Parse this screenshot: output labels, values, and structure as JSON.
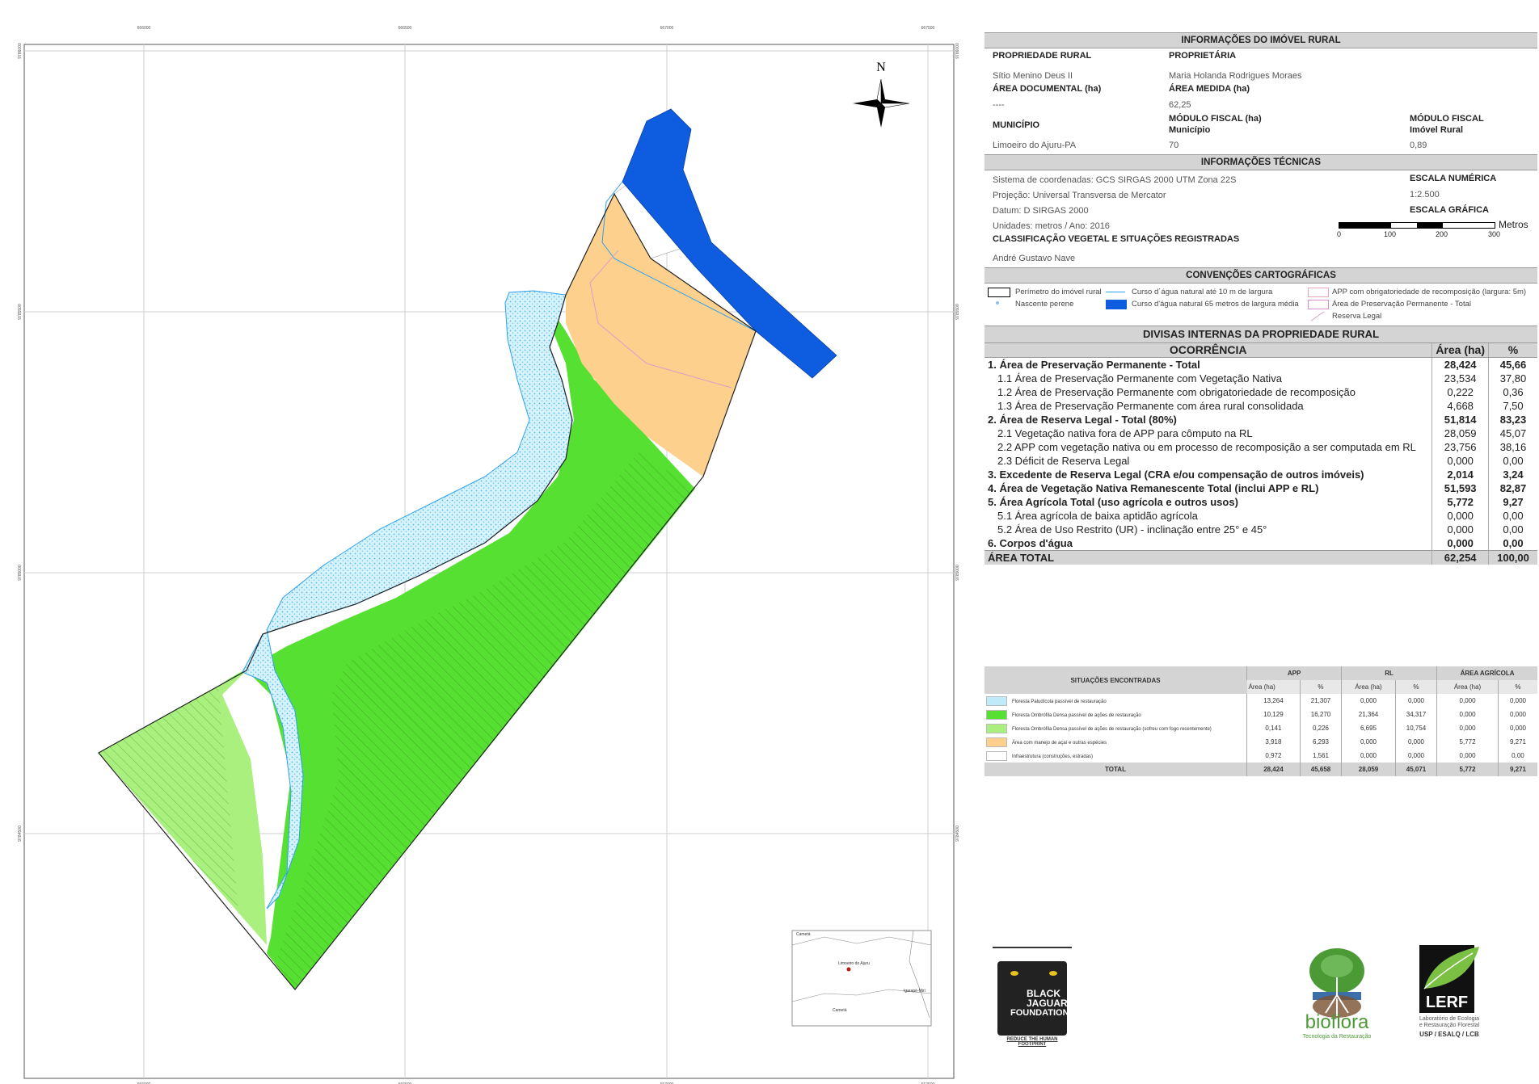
{
  "map": {
    "north_label": "N",
    "top_ticks": [
      "666000",
      "666500",
      "667000",
      "667500"
    ],
    "bottom_ticks": [
      "666000",
      "666500",
      "667000",
      "667500"
    ],
    "left_ticks": [
      "9786000",
      "9785500",
      "9785000",
      "9784500"
    ],
    "right_ticks": [
      "9786000",
      "9785500",
      "9785000",
      "9784500"
    ],
    "colors": {
      "boundary_fill_pasture": "#a9f07f",
      "forest_green": "#56e031",
      "floodplain_blue": "#bfeaf7",
      "acai_orange": "#fdd08e",
      "river_blue": "#0e5de0",
      "stream_blue": "#2ea1f0"
    }
  },
  "inset": {
    "places": [
      "Cametá",
      "Limoeiro do Ajuru",
      "Igarapé-Miri",
      "Cametá"
    ]
  },
  "info": {
    "title": "INFORMAÇÕES DO IMÓVEL RURAL",
    "propriedade_label": "PROPRIEDADE RURAL",
    "propriedade_value": "Sítio Menino Deus II",
    "proprietaria_label": "PROPRIETÁRIA",
    "proprietaria_value": "Maria Holanda Rodrigues Moraes",
    "area_doc_label": "ÁREA DOCUMENTAL (ha)",
    "area_doc_value": "----",
    "area_medida_label": "ÁREA MEDIDA (ha)",
    "area_medida_value": "62,25",
    "municipio_label": "MUNICÍPIO",
    "municipio_value": "Limoeiro do Ajuru-PA",
    "modulo_mun_label1": "MÓDULO FISCAL (ha)",
    "modulo_mun_label2": "Município",
    "modulo_mun_value": "70",
    "modulo_imovel_label1": "MÓDULO FISCAL",
    "modulo_imovel_label2": "Imóvel Rural",
    "modulo_imovel_value": "0,89"
  },
  "tecnicas": {
    "title": "INFORMAÇÕES TÉCNICAS",
    "sistema": "Sistema de coordenadas: GCS SIRGAS 2000 UTM Zona 22S",
    "projecao": "Projeção: Universal Transversa de Mercator",
    "datum": "Datum: D SIRGAS 2000",
    "unidades": "Unidades: metros / Ano: 2016",
    "classificacao_label": "CLASSIFICAÇÃO VEGETAL E SITUAÇÕES REGISTRADAS",
    "classificacao_value": "André Gustavo Nave",
    "escala_num_label": "ESCALA NUMÉRICA",
    "escala_num_value": "1:2.500",
    "escala_graf_label": "ESCALA GRÁFICA",
    "escala_unit": "Metros",
    "escala_ticks": [
      "0",
      "100",
      "200",
      "300"
    ]
  },
  "convencoes": {
    "title": "CONVENÇÕES CARTOGRÁFICAS",
    "items": [
      "Perímetro do imóvel rural",
      "Curso d´água natural até 10 m de largura",
      "APP com obrigatoriedade de recomposição (largura: 5m)",
      "Nascente perene",
      "Curso d'água natural 65 metros de largura média",
      "Área de Preservação Permanente - Total",
      "Reserva Legal"
    ]
  },
  "divisas": {
    "title": "DIVISAS INTERNAS DA PROPRIEDADE RURAL",
    "col_ocorrencia": "OCORRÊNCIA",
    "col_area": "Área (ha)",
    "col_pct": "%",
    "rows": [
      {
        "label": "1. Área de Preservação Permanente - Total",
        "area": "28,424",
        "pct": "45,66",
        "bold": true
      },
      {
        "label": "1.1 Área de Preservação Permanente com Vegetação Nativa",
        "area": "23,534",
        "pct": "37,80",
        "bold": false
      },
      {
        "label": "1.2 Área de Preservação Permanente com obrigatoriedade de recomposição",
        "area": "0,222",
        "pct": "0,36",
        "bold": false
      },
      {
        "label": "1.3 Área de Preservação Permanente com área rural consolidada",
        "area": "4,668",
        "pct": "7,50",
        "bold": false
      },
      {
        "label": "2. Área de Reserva Legal - Total (80%)",
        "area": "51,814",
        "pct": "83,23",
        "bold": true
      },
      {
        "label": "2.1 Vegetação nativa fora de APP para cômputo na RL",
        "area": "28,059",
        "pct": "45,07",
        "bold": false
      },
      {
        "label": "2.2 APP com vegetação nativa ou em processo de recomposição a ser computada em RL",
        "area": "23,756",
        "pct": "38,16",
        "bold": false
      },
      {
        "label": "2.3 Déficit de Reserva Legal",
        "area": "0,000",
        "pct": "0,00",
        "bold": false
      },
      {
        "label": "3. Excedente de Reserva Legal (CRA e/ou compensação de outros imóveis)",
        "area": "2,014",
        "pct": "3,24",
        "bold": true
      },
      {
        "label": "4. Área de  Vegetação Nativa Remanescente Total (inclui APP e RL)",
        "area": "51,593",
        "pct": "82,87",
        "bold": true
      },
      {
        "label": "5. Área Agrícola Total (uso agrícola e outros usos)",
        "area": "5,772",
        "pct": "9,27",
        "bold": true
      },
      {
        "label": "5.1 Área agrícola de baixa aptidão agrícola",
        "area": "0,000",
        "pct": "0,00",
        "bold": false
      },
      {
        "label": "5.2 Área de Uso Restrito (UR) - inclinação entre 25° e 45°",
        "area": "0,000",
        "pct": "0,00",
        "bold": false
      },
      {
        "label": "6. Corpos d'água",
        "area": "0,000",
        "pct": "0,00",
        "bold": true
      }
    ],
    "total": {
      "label": "ÁREA TOTAL",
      "area": "62,254",
      "pct": "100,00"
    }
  },
  "situacoes": {
    "title": "SITUAÇÕES ENCONTRADAS",
    "groups": [
      "APP",
      "RL",
      "ÁREA AGRÍCOLA"
    ],
    "sub": [
      "Área (ha)",
      "%",
      "Área (ha)",
      "%",
      "Área (ha)",
      "%"
    ],
    "rows": [
      {
        "swatch": "#bfeaf7",
        "label": "Floresta Paludícola passível de restauração",
        "v": [
          "13,264",
          "21,307",
          "0,000",
          "0,000",
          "0,000",
          "0,000"
        ]
      },
      {
        "swatch": "#56e031",
        "label": "Floresta Ombrófila Densa passível de ações de restauração",
        "v": [
          "10,129",
          "16,270",
          "21,364",
          "34,317",
          "0,000",
          "0,000"
        ]
      },
      {
        "swatch": "#a9f07f",
        "label": "Floresta Ombrófila Densa passível de ações de restauração (sofreu com fogo recentemente)",
        "v": [
          "0,141",
          "0,226",
          "6,695",
          "10,754",
          "0,000",
          "0,000"
        ]
      },
      {
        "swatch": "#fdd08e",
        "label": "Área com manejo de açaí e outras espécies",
        "v": [
          "3,918",
          "6,293",
          "0,000",
          "0,000",
          "5,772",
          "9,271"
        ]
      },
      {
        "swatch": "#ffffff",
        "label": "Infraestrutura (construções, estradas)",
        "v": [
          "0,972",
          "1,561",
          "0,000",
          "0,000",
          "0,000",
          "0,00"
        ]
      }
    ],
    "total": {
      "label": "TOTAL",
      "v": [
        "28,424",
        "45,658",
        "28,059",
        "45,071",
        "5,772",
        "9,271"
      ]
    }
  },
  "logos": {
    "bjf_line1": "BLACK",
    "bjf_line2": "JAGUAR",
    "bjf_line3": "FOUNDATION",
    "bjf_tagline": "REDUCE THE HUMAN FOOTPRINT",
    "bioflora_name": "bioflora",
    "bioflora_tagline": "Tecnologia da Restauração",
    "lerf_name": "LERF",
    "lerf_line1": "Laboratório de Ecologia",
    "lerf_line2": "e Restauração Florestal",
    "lerf_line3": "USP / ESALQ / LCB"
  }
}
